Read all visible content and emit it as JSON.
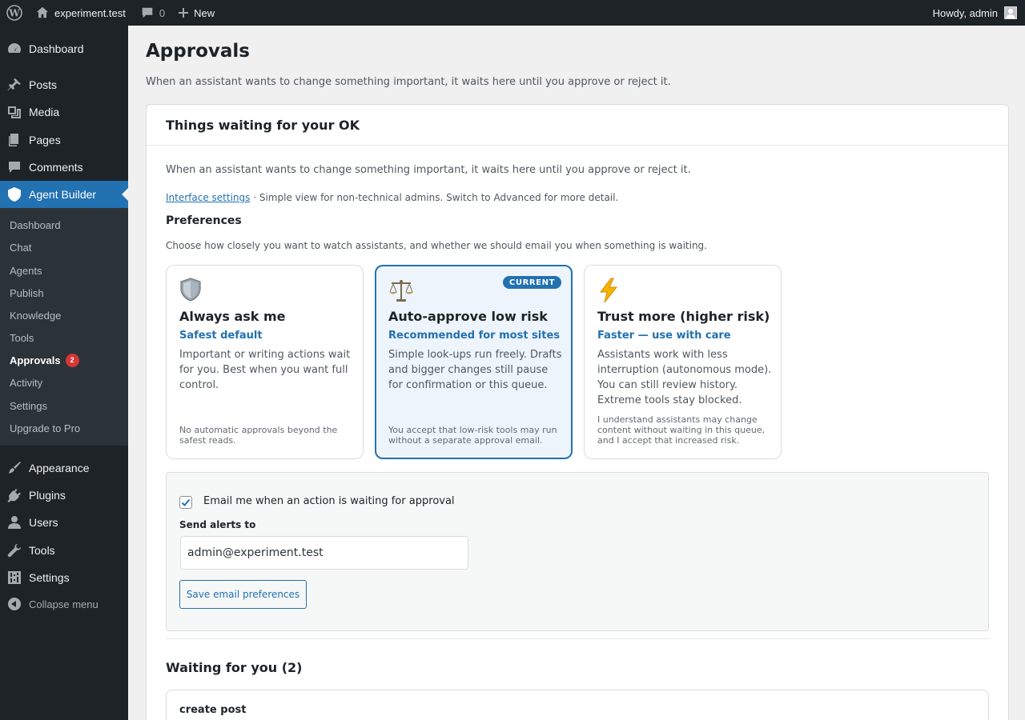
{
  "adminbar": {
    "site_name": "experiment.test",
    "comment_count": "0",
    "new_label": "New",
    "howdy": "Howdy, admin"
  },
  "sidebar": {
    "items_top": [
      {
        "label": "Dashboard",
        "icon": "dashboard-icon"
      },
      {
        "label": "Posts",
        "icon": "pushpin-icon"
      },
      {
        "label": "Media",
        "icon": "media-icon"
      },
      {
        "label": "Pages",
        "icon": "pages-icon"
      },
      {
        "label": "Comments",
        "icon": "comment-icon"
      },
      {
        "label": "Agent Builder",
        "icon": "agent-builder-icon"
      }
    ],
    "submenu": [
      {
        "label": "Dashboard"
      },
      {
        "label": "Chat"
      },
      {
        "label": "Agents"
      },
      {
        "label": "Publish"
      },
      {
        "label": "Knowledge"
      },
      {
        "label": "Tools"
      },
      {
        "label": "Approvals",
        "badge": "2"
      },
      {
        "label": "Activity"
      },
      {
        "label": "Settings"
      },
      {
        "label": "Upgrade to Pro"
      }
    ],
    "items_bottom": [
      {
        "label": "Appearance",
        "icon": "paintbrush-icon"
      },
      {
        "label": "Plugins",
        "icon": "plugin-icon"
      },
      {
        "label": "Users",
        "icon": "users-icon"
      },
      {
        "label": "Tools",
        "icon": "wrench-icon"
      },
      {
        "label": "Settings",
        "icon": "settings-icon"
      }
    ],
    "collapse_label": "Collapse menu"
  },
  "page": {
    "title": "Approvals",
    "description": "When an assistant wants to change something important, it waits here until you approve or reject it."
  },
  "card": {
    "heading": "Things waiting for your OK",
    "intro": "When an assistant wants to change something important, it waits here until you approve or reject it.",
    "interface_link": "Interface settings",
    "interface_note": " · Simple view for non-technical admins. Switch to Advanced for more detail.",
    "prefs_title": "Preferences",
    "prefs_desc": "Choose how closely you want to watch assistants, and whether we should email you when something is waiting.",
    "modes": [
      {
        "icon": "shield-icon",
        "title": "Always ask me",
        "subtitle": "Safest default",
        "description": "Important or writing actions wait for you. Best when you want full control.",
        "footnote": "No automatic approvals beyond the safest reads.",
        "current": false
      },
      {
        "icon": "scales-icon",
        "title": "Auto-approve low risk",
        "subtitle": "Recommended for most sites",
        "description": "Simple look-ups run freely. Drafts and bigger changes still pause for confirmation or this queue.",
        "footnote": "You accept that low-risk tools may run without a separate approval email.",
        "current": true,
        "badge": "CURRENT"
      },
      {
        "icon": "lightning-icon",
        "title": "Trust more (higher risk)",
        "subtitle": "Faster — use with care",
        "description": "Assistants work with less interruption (autonomous mode). You can still review history. Extreme tools stay blocked.",
        "footnote": "I understand assistants may change content without waiting in this queue, and I accept that increased risk.",
        "current": false
      }
    ],
    "email": {
      "checkbox_label": "Email me when an action is waiting for approval",
      "checked": true,
      "send_label": "Send alerts to",
      "address": "admin@experiment.test",
      "save_label": "Save email preferences"
    },
    "waiting_title": "Waiting for you (2)",
    "queue": [
      {
        "title": "create post"
      }
    ]
  },
  "colors": {
    "accent": "#2271b1",
    "admin_bg": "#1d2327",
    "badge_red": "#d63638"
  }
}
